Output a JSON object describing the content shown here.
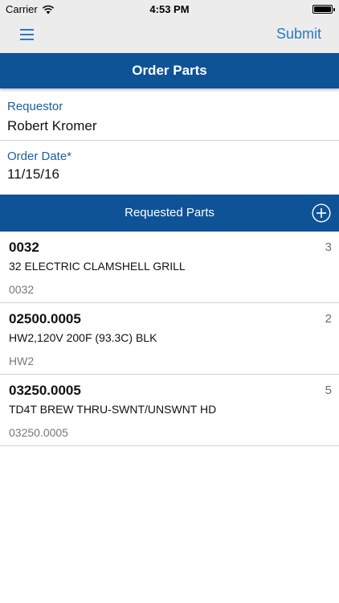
{
  "status_bar": {
    "carrier": "Carrier",
    "time": "4:53 PM"
  },
  "nav": {
    "submit_label": "Submit"
  },
  "page": {
    "title": "Order Parts"
  },
  "form": {
    "requestor_label": "Requestor",
    "requestor_value": "Robert Kromer",
    "order_date_label": "Order Date*",
    "order_date_value": "11/15/16"
  },
  "parts_section": {
    "title": "Requested Parts",
    "items": [
      {
        "number": "0032",
        "description": "32 ELECTRIC CLAMSHELL GRILL",
        "code": "0032",
        "qty": "3"
      },
      {
        "number": "02500.0005",
        "description": "HW2,120V 200F (93.3C) BLK",
        "code": "HW2",
        "qty": "2"
      },
      {
        "number": "03250.0005",
        "description": "TD4T BREW THRU-SWNT/UNSWNT HD",
        "code": "03250.0005",
        "qty": "5"
      }
    ]
  },
  "icons": {
    "menu": "hamburger-menu-icon",
    "add": "plus-circle-icon",
    "wifi": "wifi-icon",
    "battery": "battery-icon"
  },
  "colors": {
    "brand_blue": "#0e5396",
    "link_blue": "#2c78c6",
    "label_blue": "#1a5e9e",
    "bar_gray": "#ececec"
  }
}
